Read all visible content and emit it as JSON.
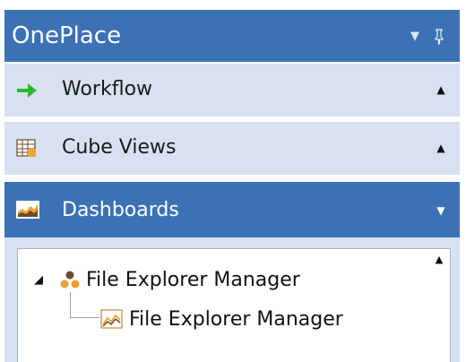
{
  "panel": {
    "title": "OnePlace",
    "dropdown_glyph": "▼",
    "pin_glyph": "ꟼ"
  },
  "sections": [
    {
      "label": "Workflow",
      "icon": "green-arrow-icon",
      "chevron": "▲",
      "active": false
    },
    {
      "label": "Cube Views",
      "icon": "grid-table-icon",
      "chevron": "▲",
      "active": false
    },
    {
      "label": "Dashboards",
      "icon": "area-chart-icon",
      "chevron": "▼",
      "active": true
    }
  ],
  "tree": {
    "scroll_glyph": "▲",
    "group": {
      "label": "File Explorer Manager",
      "expander": "◢",
      "icon": "maintenance-unit-icon"
    },
    "child": {
      "label": "File Explorer Manager",
      "icon": "dashboard-chart-icon"
    }
  },
  "colors": {
    "header_bg": "#3c72b5",
    "section_bg": "#d8e1f1",
    "active_bg": "#3c72b5",
    "arrow_green": "#2eb82e"
  }
}
